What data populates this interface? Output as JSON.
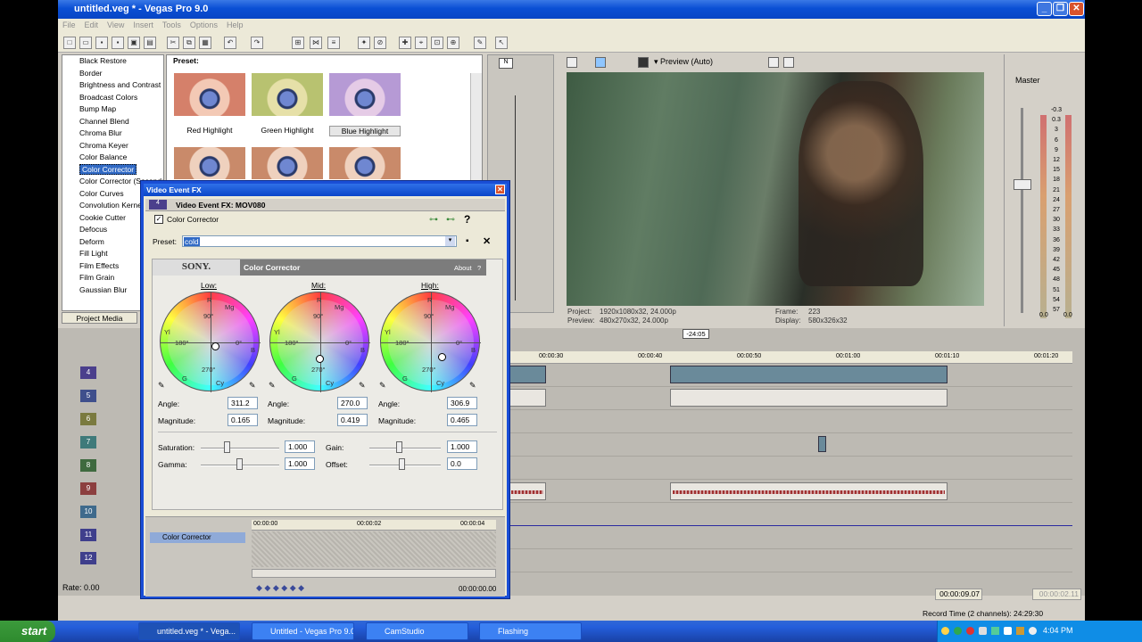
{
  "window": {
    "title": "untitled.veg * - Vegas Pro 9.0"
  },
  "menu": [
    "File",
    "Edit",
    "View",
    "Insert",
    "Tools",
    "Options",
    "Help"
  ],
  "fx_list": [
    "Black Restore",
    "Border",
    "Brightness and Contrast",
    "Broadcast Colors",
    "Bump Map",
    "Channel Blend",
    "Chroma Blur",
    "Chroma Keyer",
    "Color Balance",
    "Color Corrector",
    "Color Corrector (Secondary)",
    "Color Curves",
    "Convolution Kernel",
    "Cookie Cutter",
    "Defocus",
    "Deform",
    "Fill Light",
    "Film Effects",
    "Film Grain",
    "Gaussian Blur"
  ],
  "fx_selected": "Color Corrector",
  "preset_panel": {
    "label": "Preset:",
    "items": [
      "Red Highlight",
      "Green Highlight",
      "Blue Highlight"
    ]
  },
  "project_media_tab": "Project Media",
  "preview": {
    "mode": "Preview (Auto)",
    "project_label": "Project:",
    "project": "1920x1080x32, 24.000p",
    "preview_label": "Preview:",
    "preview_val": "480x270x32, 24.000p",
    "frame_label": "Frame:",
    "frame": "223",
    "display_label": "Display:",
    "display": "580x326x32"
  },
  "master": {
    "label": "Master",
    "scale": [
      "-0.3",
      "0.3",
      "3",
      "6",
      "9",
      "12",
      "15",
      "18",
      "21",
      "24",
      "27",
      "30",
      "33",
      "36",
      "39",
      "42",
      "45",
      "48",
      "51",
      "54",
      "57"
    ],
    "bottom_left": "0.0",
    "bottom_right": "0.0"
  },
  "timeline": {
    "marker": "-24:05",
    "times": [
      "00:00:30",
      "00:00:40",
      "00:00:50",
      "00:01:00",
      "00:01:10",
      "00:01:20"
    ],
    "tracks": [
      "4",
      "5",
      "6",
      "7",
      "8",
      "9",
      "10",
      "11",
      "12"
    ],
    "track_colors": [
      "#4b3f8c",
      "#3f4f8c",
      "#7a7a3f",
      "#3f7a7a",
      "#3f6a3f",
      "#8c3f3f",
      "#3f6a8c",
      "#3f3f8c",
      "#3f3f8c"
    ],
    "rate": "Rate: 0.00",
    "time_counter": "00:00:09.07",
    "time_counter2": "00:00:02.11",
    "record_time": "Record Time (2 channels): 24:29:30"
  },
  "dialog": {
    "title": "Video Event FX",
    "event": "Video Event FX: MOV080",
    "chain_item": "Color Corrector",
    "preset_label": "Preset:",
    "preset_value": "cold",
    "brand": "SONY.",
    "plugin": "Color Corrector",
    "about": "About",
    "help": "?",
    "wheels": [
      {
        "name": "Low:",
        "angle_label": "Angle:",
        "angle": "311.2",
        "mag_label": "Magnitude:",
        "magnitude": "0.165"
      },
      {
        "name": "Mid:",
        "angle_label": "Angle:",
        "angle": "270.0",
        "mag_label": "Magnitude:",
        "magnitude": "0.419"
      },
      {
        "name": "High:",
        "angle_label": "Angle:",
        "angle": "306.9",
        "mag_label": "Magnitude:",
        "magnitude": "0.465"
      }
    ],
    "wheel_labels": {
      "r": "R",
      "mg": "Mg",
      "yl": "Yl",
      "b": "B",
      "g": "G",
      "cy": "Cy",
      "d90": "90°",
      "d180": "180°",
      "d0": "0°",
      "d270": "270°"
    },
    "saturation_label": "Saturation:",
    "saturation": "1.000",
    "gain_label": "Gain:",
    "gain": "1.000",
    "gamma_label": "Gamma:",
    "gamma": "1.000",
    "offset_label": "Offset:",
    "offset": "0.0",
    "timeline_times": [
      "00:00:00",
      "00:00:02",
      "00:00:04"
    ],
    "track_label": "Color Corrector",
    "time_display": "00:00:00.00"
  },
  "taskbar": {
    "start": "start",
    "tasks": [
      "untitled.veg * - Vega...",
      "Untitled - Vegas Pro 9.0",
      "CamStudio",
      "Flashing"
    ],
    "clock": "4:04 PM"
  }
}
